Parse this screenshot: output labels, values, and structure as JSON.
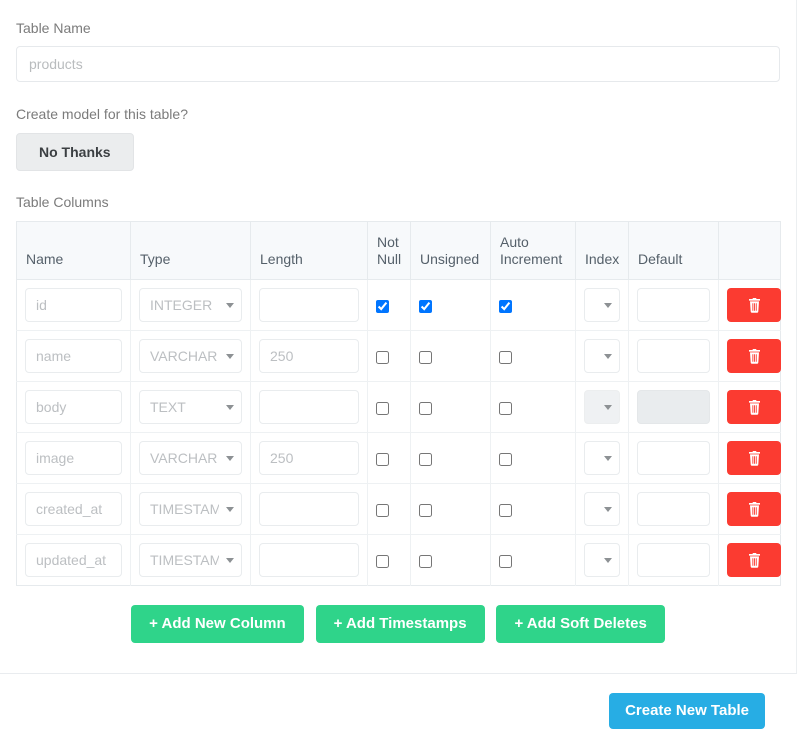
{
  "form": {
    "table_name_label": "Table Name",
    "table_name_value": "products",
    "table_name_placeholder": "products",
    "create_model_label": "Create model for this table?",
    "no_thanks_label": "No Thanks",
    "table_columns_label": "Table Columns"
  },
  "columns_table": {
    "headers": [
      "Name",
      "Type",
      "Length",
      "Not Null",
      "Unsigned",
      "Auto Increment",
      "Index",
      "Default",
      ""
    ],
    "rows": [
      {
        "name": "id",
        "type": "INTEGER",
        "length": "",
        "not_null": true,
        "unsigned": true,
        "auto_increment": true,
        "index": "",
        "default": "",
        "disabled": false
      },
      {
        "name": "name",
        "type": "VARCHAR",
        "length": "250",
        "not_null": false,
        "unsigned": false,
        "auto_increment": false,
        "index": "",
        "default": "",
        "disabled": false
      },
      {
        "name": "body",
        "type": "TEXT",
        "length": "",
        "not_null": false,
        "unsigned": false,
        "auto_increment": false,
        "index": "",
        "default": "",
        "disabled": true
      },
      {
        "name": "image",
        "type": "VARCHAR",
        "length": "250",
        "not_null": false,
        "unsigned": false,
        "auto_increment": false,
        "index": "",
        "default": "",
        "disabled": false
      },
      {
        "name": "created_at",
        "type": "TIMESTAMP",
        "length": "",
        "not_null": false,
        "unsigned": false,
        "auto_increment": false,
        "index": "",
        "default": "",
        "disabled": false
      },
      {
        "name": "updated_at",
        "type": "TIMESTAMP",
        "length": "",
        "not_null": false,
        "unsigned": false,
        "auto_increment": false,
        "index": "",
        "default": "",
        "disabled": false
      }
    ],
    "delete_icon": "trash-icon"
  },
  "actions": {
    "add_new_column": "+ Add New Column",
    "add_timestamps": "+ Add Timestamps",
    "add_soft_deletes": "+ Add Soft Deletes"
  },
  "footer": {
    "create_table_label": "Create New Table"
  },
  "colors": {
    "green": "#2fd48a",
    "blue": "#27ade4",
    "red": "#fb3b31",
    "header_bg": "#f7f9fb"
  }
}
